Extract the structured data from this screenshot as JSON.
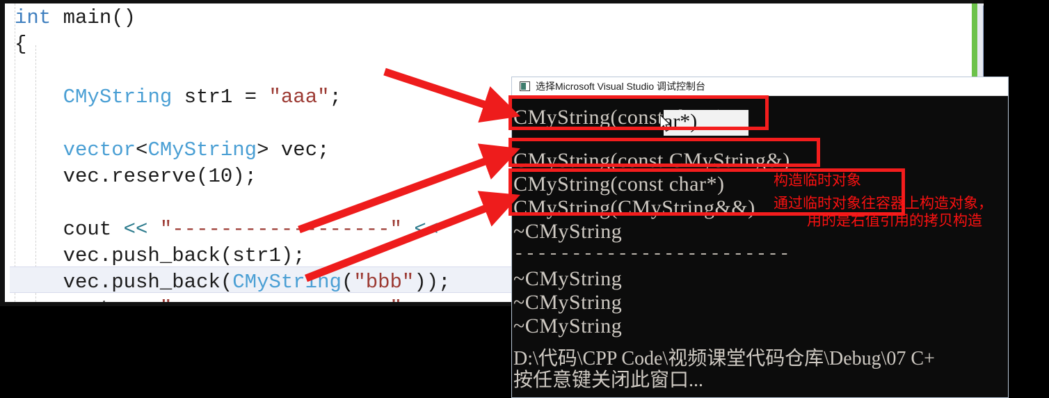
{
  "editor": {
    "app": "Visual Studio code editor",
    "lines": [
      {
        "tokens": [
          {
            "t": "int",
            "c": "kw-blue"
          },
          {
            "t": " main()",
            "c": ""
          }
        ]
      },
      {
        "tokens": [
          {
            "t": "{",
            "c": ""
          }
        ]
      },
      {
        "tokens": []
      },
      {
        "tokens": [
          {
            "t": "    ",
            "c": ""
          },
          {
            "t": "CMyString",
            "c": "type-blue"
          },
          {
            "t": " str1 = ",
            "c": ""
          },
          {
            "t": "\"aaa\"",
            "c": "str-red"
          },
          {
            "t": ";",
            "c": ""
          }
        ]
      },
      {
        "tokens": []
      },
      {
        "tokens": [
          {
            "t": "    ",
            "c": ""
          },
          {
            "t": "vector",
            "c": "type-blue"
          },
          {
            "t": "<",
            "c": ""
          },
          {
            "t": "CMyString",
            "c": "type-blue"
          },
          {
            "t": "> vec;",
            "c": ""
          }
        ]
      },
      {
        "tokens": [
          {
            "t": "    vec.reserve(10);",
            "c": ""
          }
        ]
      },
      {
        "tokens": []
      },
      {
        "tokens": [
          {
            "t": "    cout ",
            "c": ""
          },
          {
            "t": "<<",
            "c": "op-teal"
          },
          {
            "t": " ",
            "c": ""
          },
          {
            "t": "\"------------------\"",
            "c": "str-red"
          },
          {
            "t": " ",
            "c": ""
          },
          {
            "t": "<<",
            "c": "op-teal"
          }
        ]
      },
      {
        "tokens": [
          {
            "t": "    vec.push_back(str1);",
            "c": ""
          }
        ]
      },
      {
        "tokens": [
          {
            "t": "    vec.push_back(",
            "c": ""
          },
          {
            "t": "CMyString",
            "c": "type-blue"
          },
          {
            "t": "(",
            "c": ""
          },
          {
            "t": "\"bbb\"",
            "c": "str-red"
          },
          {
            "t": "));",
            "c": ""
          }
        ]
      },
      {
        "tokens": [
          {
            "t": "    cout ",
            "c": ""
          },
          {
            "t": "<<",
            "c": "op-teal"
          },
          {
            "t": " ",
            "c": ""
          },
          {
            "t": "\"------------------\"",
            "c": "str-red"
          },
          {
            "t": " ",
            "c": ""
          },
          {
            "t": "<<",
            "c": "op-teal"
          }
        ]
      }
    ],
    "current_line_index": 11,
    "change_bar_color": "#6cc24a",
    "scrollbar_thumb_color": "#2b3a5c"
  },
  "console": {
    "title": "选择Microsoft Visual Studio 调试控制台",
    "lines": [
      {
        "text": "CMyString(const char*)",
        "kind": "out"
      },
      {
        "text": "------------------------",
        "kind": "sep"
      },
      {
        "text": "CMyString(const CMyString&)",
        "kind": "out"
      },
      {
        "text": "CMyString(const char*)",
        "kind": "out"
      },
      {
        "text": "CMyString(CMyString&&)",
        "kind": "out"
      },
      {
        "text": "~CMyString",
        "kind": "out"
      },
      {
        "text": "------------------------",
        "kind": "sep"
      },
      {
        "text": "~CMyString",
        "kind": "out"
      },
      {
        "text": "~CMyString",
        "kind": "out"
      },
      {
        "text": "~CMyString",
        "kind": "out"
      }
    ],
    "selection_text": "ar*)",
    "path_line": "D:\\代码\\CPP Code\\视频课堂代码仓库\\Debug\\07 C+",
    "prompt_line": "按任意键关闭此窗口..."
  },
  "annotations": {
    "note_1": "构造临时对象",
    "note_2a": "通过临时对象往容器上构造对象，",
    "note_2b": "用的是右值引用的拷贝构造",
    "highlight_color": "#f41d1d",
    "arrow_color": "#ee1c1c"
  }
}
